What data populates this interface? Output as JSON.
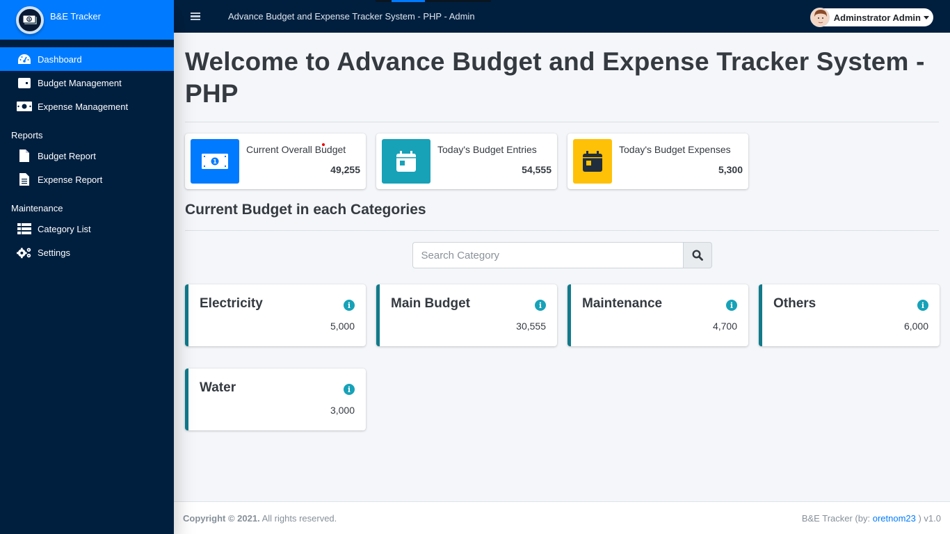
{
  "brand": {
    "name": "B&E Tracker",
    "logo_icon": "money-bill-icon"
  },
  "sidebar": {
    "items": [
      {
        "label": "Dashboard",
        "icon": "tachometer-icon",
        "active": true
      },
      {
        "label": "Budget Management",
        "icon": "wallet-icon"
      },
      {
        "label": "Expense Management",
        "icon": "money-bill-icon"
      }
    ],
    "reports_header": "Reports",
    "reports": [
      {
        "label": "Budget Report",
        "icon": "file-icon"
      },
      {
        "label": "Expense Report",
        "icon": "file-alt-icon"
      }
    ],
    "maintenance_header": "Maintenance",
    "maintenance": [
      {
        "label": "Category List",
        "icon": "table-list-icon"
      },
      {
        "label": "Settings",
        "icon": "cogs-icon"
      }
    ]
  },
  "topbar": {
    "title": "Advance Budget and Expense Tracker System - PHP - Admin",
    "loading_progress_percent": 29,
    "user_name": "Adminstrator Admin"
  },
  "main": {
    "page_title": "Welcome to Advance Budget and Expense Tracker System - PHP",
    "stats": [
      {
        "label": "Current Overall Budget",
        "value": "49,255",
        "icon": "money-bill-icon",
        "color": "#007bff"
      },
      {
        "label": "Today's Budget Entries",
        "value": "54,555",
        "icon": "calendar-day-icon",
        "color": "#17a2b8"
      },
      {
        "label": "Today's Budget Expenses",
        "value": "5,300",
        "icon": "calendar-day-icon",
        "color": "#ffc107"
      }
    ],
    "section_title": "Current Budget in each Categories",
    "search": {
      "placeholder": "Search Category",
      "value": ""
    },
    "categories": [
      {
        "name": "Electricity",
        "amount": "5,000"
      },
      {
        "name": "Main Budget",
        "amount": "30,555"
      },
      {
        "name": "Maintenance",
        "amount": "4,700"
      },
      {
        "name": "Others",
        "amount": "6,000"
      },
      {
        "name": "Water",
        "amount": "3,000"
      }
    ],
    "category_accent_color": "#117a8b"
  },
  "footer": {
    "copyright_bold": "Copyright © 2021.",
    "copyright_rest": " All rights reserved.",
    "credit_prefix": "B&E Tracker (by: ",
    "credit_link": "oretnom23",
    "credit_suffix": " ) v1.0"
  }
}
